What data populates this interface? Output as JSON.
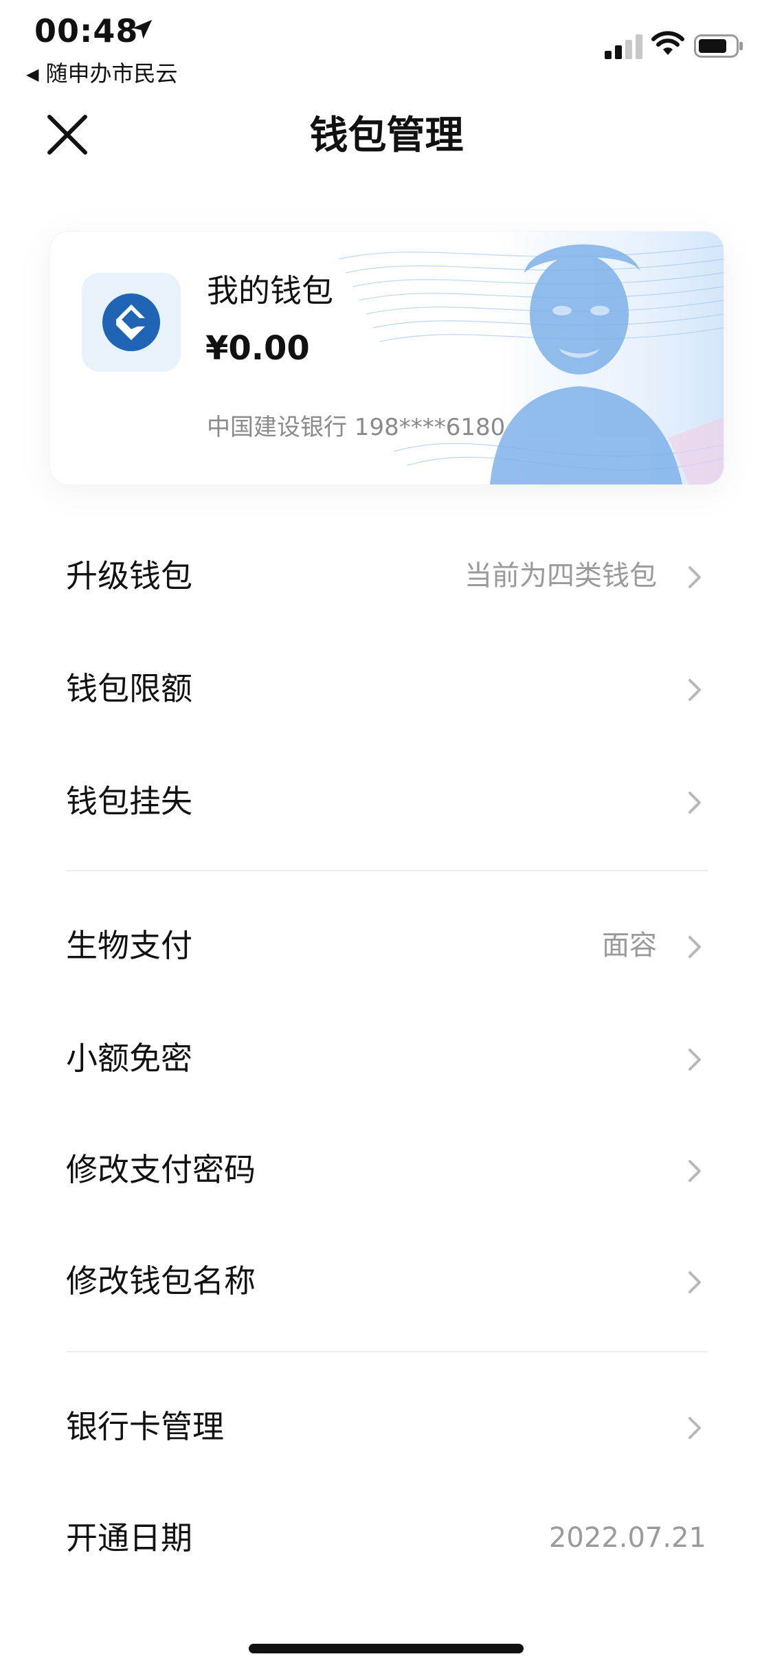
{
  "status_bar": {
    "time": "00:48",
    "back_app": "随申办市民云",
    "location_icon": "location-arrow-icon",
    "signal_icon": "cellular-signal-icon",
    "wifi_icon": "wifi-icon",
    "battery_icon": "battery-icon"
  },
  "header": {
    "title": "钱包管理",
    "close_icon": "close-icon"
  },
  "wallet": {
    "name": "我的钱包",
    "balance": "¥0.00",
    "bank_info": "中国建设银行 198****6180",
    "logo_icon": "ccb-bank-logo-icon",
    "accent": "#1f64b5"
  },
  "menu": {
    "upgrade": {
      "label": "升级钱包",
      "value": "当前为四类钱包"
    },
    "limit": {
      "label": "钱包限额"
    },
    "report_loss": {
      "label": "钱包挂失"
    },
    "biometric": {
      "label": "生物支付",
      "value": "面容"
    },
    "small_free": {
      "label": "小额免密"
    },
    "change_password": {
      "label": "修改支付密码"
    },
    "rename": {
      "label": "修改钱包名称"
    },
    "bank_card": {
      "label": "银行卡管理"
    },
    "open_date": {
      "label": "开通日期",
      "value": "2022.07.21"
    }
  },
  "colors": {
    "text_primary": "#111111",
    "text_secondary": "#9a9a9a",
    "divider": "#eeeeee",
    "card_art_blue": "#8fbdef"
  }
}
